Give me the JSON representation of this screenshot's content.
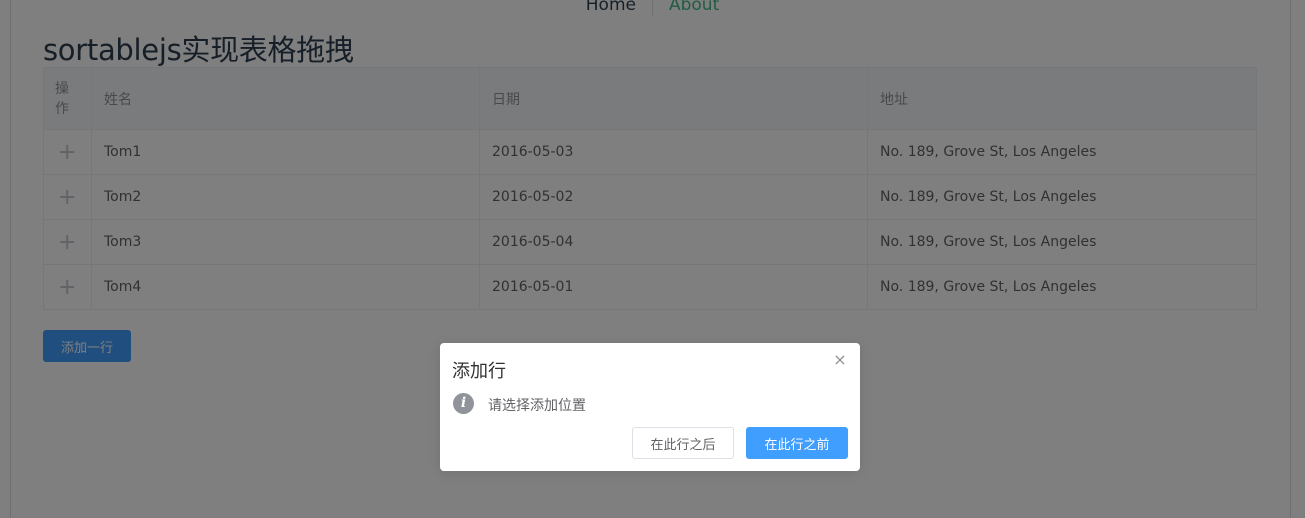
{
  "nav": {
    "home": "Home",
    "about": "About"
  },
  "page": {
    "title": "sortablejs实现表格拖拽"
  },
  "table": {
    "headers": {
      "op": "操作",
      "name": "姓名",
      "date": "日期",
      "address": "地址"
    },
    "drag_icon": "+",
    "rows": [
      {
        "name": "Tom1",
        "date": "2016-05-03",
        "address": "No. 189, Grove St, Los Angeles"
      },
      {
        "name": "Tom2",
        "date": "2016-05-02",
        "address": "No. 189, Grove St, Los Angeles"
      },
      {
        "name": "Tom3",
        "date": "2016-05-04",
        "address": "No. 189, Grove St, Los Angeles"
      },
      {
        "name": "Tom4",
        "date": "2016-05-01",
        "address": "No. 189, Grove St, Los Angeles"
      }
    ]
  },
  "actions": {
    "add_row": "添加一行"
  },
  "dialog": {
    "title": "添加行",
    "close": "×",
    "info_icon": "i",
    "message": "请选择添加位置",
    "btn_after": "在此行之后",
    "btn_before": "在此行之前"
  },
  "colors": {
    "primary": "#409eff",
    "link_active": "#42b983",
    "overlay": "rgba(0,0,0,0.5)"
  }
}
